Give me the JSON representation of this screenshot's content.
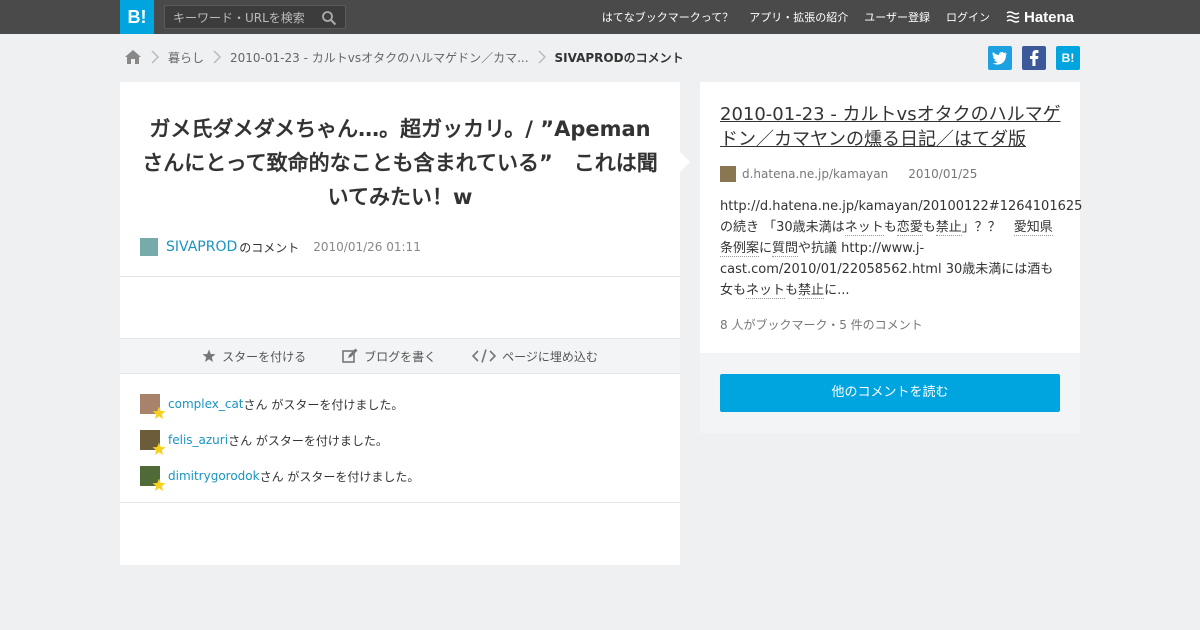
{
  "header": {
    "logo_text": "B!",
    "search_placeholder": "キーワード・URLを検索",
    "nav": [
      "はてなブックマークって？",
      "アプリ・拡張の紹介",
      "ユーザー登録",
      "ログイン"
    ],
    "hatena_logo_text": "Hatena"
  },
  "breadcrumb": {
    "items": [
      "暮らし",
      "2010-01-23 - カルトvsオタクのハルマゲドン／カマ...",
      "SIVAPRODのコメント"
    ]
  },
  "share": {
    "bookmark_label": "B!"
  },
  "comment": {
    "text": "ガメ氏ダメダメちゃん…。超ガッカリ。/ ”Apemanさんにとって致命的なことも含まれている”　これは聞いてみたい！w",
    "author": "SIVAPROD",
    "author_suffix": "のコメント",
    "date": "2010/01/26 01:11"
  },
  "actions": {
    "star": "スターを付ける",
    "blog": "ブログを書く",
    "embed": "ページに埋め込む"
  },
  "stars": [
    {
      "user": "complex_cat",
      "text": "さん がスターを付けました。"
    },
    {
      "user": "felis_azuri",
      "text": "さん がスターを付けました。"
    },
    {
      "user": "dimitrygorodok",
      "text": "さん がスターを付けました。"
    }
  ],
  "entry": {
    "title": "2010-01-23 - カルトvsオタクのハルマゲドン／カマヤンの燻る日記／はてダ版",
    "domain": "d.hatena.ne.jp/kamayan",
    "date": "2010/01/25",
    "summary_1": "http://d.hatena.ne.jp/kamayan/20100122#1264101625の続き 「30歳未満は",
    "kw_1": "ネット",
    "summary_2": "も",
    "kw_2": "恋愛",
    "summary_3": "も",
    "kw_3": "禁止",
    "summary_4": "」？？　",
    "kw_4": "愛知県条例案",
    "summary_5": "に",
    "kw_5": "質問",
    "summary_6": "や抗議 http://www.j-cast.com/2010/01/22058562.html 30歳未満には酒も女も",
    "kw_6": "ネット",
    "summary_7": "も",
    "kw_7": "禁止",
    "summary_8": "に...",
    "stats": "8 人がブックマーク・5 件のコメント",
    "read_more": "他のコメントを読む"
  },
  "colors": {
    "brand": "#00a4de",
    "header_bg": "#4a4a4a",
    "link": "#1a94c2",
    "twitter": "#1da1e2",
    "facebook": "#3b5998",
    "star": "#f5d11c"
  }
}
